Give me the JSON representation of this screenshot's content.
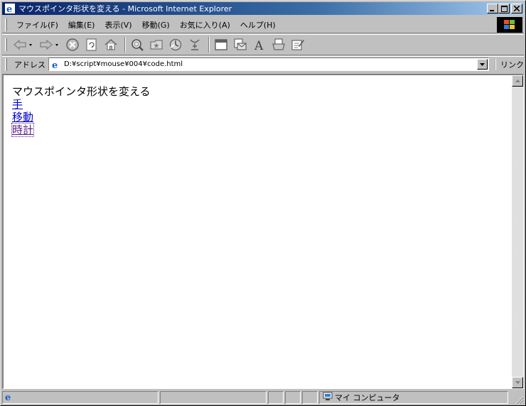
{
  "window": {
    "title": "マウスポインタ形状を変える - Microsoft Internet Explorer"
  },
  "menu": {
    "items": [
      "ファイル(F)",
      "編集(E)",
      "表示(V)",
      "移動(G)",
      "お気に入り(A)",
      "ヘルプ(H)"
    ]
  },
  "toolbar": {
    "icons": [
      "back-icon",
      "forward-icon",
      "stop-icon",
      "refresh-icon",
      "home-icon",
      "search-icon",
      "favorites-icon",
      "history-icon",
      "channels-icon",
      "fullscreen-icon",
      "mail-icon",
      "font-icon",
      "print-icon",
      "edit-icon"
    ]
  },
  "address": {
    "label": "アドレス",
    "url": "D:¥script¥mouse¥004¥code.html",
    "links_label": "リンク"
  },
  "page": {
    "heading": "マウスポインタ形状を変える",
    "links": [
      "手",
      "移動",
      "時計"
    ]
  },
  "status": {
    "zone": "マイ コンピュータ"
  },
  "colors": {
    "titlebar_start": "#0a246a",
    "titlebar_end": "#a6caf0",
    "link": "#0000cc",
    "visited_link": "#551a8b",
    "chrome": "#c0c0c0"
  }
}
